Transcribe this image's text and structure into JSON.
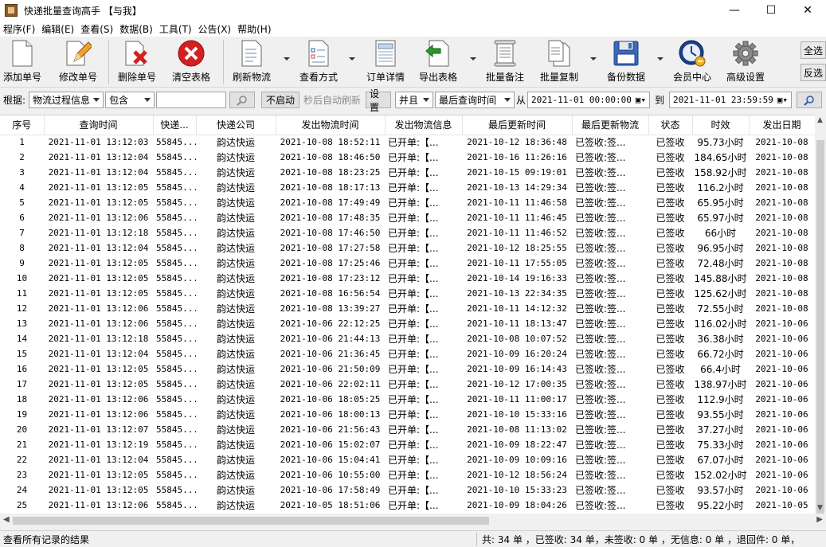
{
  "window": {
    "title": "快递批量查询高手 【与我】",
    "minimize": "—",
    "maximize": "☐",
    "close": "✕"
  },
  "menu": [
    "程序(F)",
    "编辑(E)",
    "查看(S)",
    "数据(B)",
    "工具(T)",
    "公告(X)",
    "帮助(H)"
  ],
  "toolbar": {
    "add": "添加单号",
    "edit": "修改单号",
    "delete": "删除单号",
    "clear": "清空表格",
    "refresh": "刷新物流",
    "view_mode": "查看方式",
    "order_detail": "订单详情",
    "export": "导出表格",
    "batch_note": "批量备注",
    "batch_copy": "批量复制",
    "backup": "备份数据",
    "member": "会员中心",
    "settings": "高级设置",
    "select_all": "全选",
    "invert": "反选"
  },
  "filter": {
    "label": "根据:",
    "field": "物流过程信息",
    "op": "包含",
    "search_value": "",
    "auto_off": "不启动",
    "auto_label": "秒后自动刷新",
    "settings": "设置",
    "logic": "并且",
    "time_field": "最后查询时间",
    "from_label": "从",
    "from": "2021-11-01 00:00:00",
    "to_label": "到",
    "to": "2021-11-01 23:59:59"
  },
  "table": {
    "headers": [
      "序号",
      "查询时间",
      "快递...",
      "快递公司",
      "发出物流时间",
      "发出物流信息",
      "最后更新时间",
      "最后更新物流",
      "状态",
      "时效",
      "发出日期"
    ],
    "rows": [
      [
        "1",
        "2021-11-01 13:12:03",
        "55845...",
        "韵达快运",
        "2021-10-08 18:52:11",
        "已开单:【...",
        "2021-10-12 18:36:48",
        "已签收:签...",
        "已签收",
        "95.73小时",
        "2021-10-08"
      ],
      [
        "2",
        "2021-11-01 13:12:04",
        "55845...",
        "韵达快运",
        "2021-10-08 18:46:50",
        "已开单:【...",
        "2021-10-16 11:26:16",
        "已签收:签...",
        "已签收",
        "184.65小时",
        "2021-10-08"
      ],
      [
        "3",
        "2021-11-01 13:12:04",
        "55845...",
        "韵达快运",
        "2021-10-08 18:23:25",
        "已开单:【...",
        "2021-10-15 09:19:01",
        "已签收:签...",
        "已签收",
        "158.92小时",
        "2021-10-08"
      ],
      [
        "4",
        "2021-11-01 13:12:05",
        "55845...",
        "韵达快运",
        "2021-10-08 18:17:13",
        "已开单:【...",
        "2021-10-13 14:29:34",
        "已签收:签...",
        "已签收",
        "116.2小时",
        "2021-10-08"
      ],
      [
        "5",
        "2021-11-01 13:12:05",
        "55845...",
        "韵达快运",
        "2021-10-08 17:49:49",
        "已开单:【...",
        "2021-10-11 11:46:58",
        "已签收:签...",
        "已签收",
        "65.95小时",
        "2021-10-08"
      ],
      [
        "6",
        "2021-11-01 13:12:06",
        "55845...",
        "韵达快运",
        "2021-10-08 17:48:35",
        "已开单:【...",
        "2021-10-11 11:46:45",
        "已签收:签...",
        "已签收",
        "65.97小时",
        "2021-10-08"
      ],
      [
        "7",
        "2021-11-01 13:12:18",
        "55845...",
        "韵达快运",
        "2021-10-08 17:46:50",
        "已开单:【...",
        "2021-10-11 11:46:52",
        "已签收:签...",
        "已签收",
        "66小时",
        "2021-10-08"
      ],
      [
        "8",
        "2021-11-01 13:12:04",
        "55845...",
        "韵达快运",
        "2021-10-08 17:27:58",
        "已开单:【...",
        "2021-10-12 18:25:55",
        "已签收:签...",
        "已签收",
        "96.95小时",
        "2021-10-08"
      ],
      [
        "9",
        "2021-11-01 13:12:05",
        "55845...",
        "韵达快运",
        "2021-10-08 17:25:46",
        "已开单:【...",
        "2021-10-11 17:55:05",
        "已签收:签...",
        "已签收",
        "72.48小时",
        "2021-10-08"
      ],
      [
        "10",
        "2021-11-01 13:12:05",
        "55845...",
        "韵达快运",
        "2021-10-08 17:23:12",
        "已开单:【...",
        "2021-10-14 19:16:33",
        "已签收:签...",
        "已签收",
        "145.88小时",
        "2021-10-08"
      ],
      [
        "11",
        "2021-11-01 13:12:05",
        "55845...",
        "韵达快运",
        "2021-10-08 16:56:54",
        "已开单:【...",
        "2021-10-13 22:34:35",
        "已签收:签...",
        "已签收",
        "125.62小时",
        "2021-10-08"
      ],
      [
        "12",
        "2021-11-01 13:12:06",
        "55845...",
        "韵达快运",
        "2021-10-08 13:39:27",
        "已开单:【...",
        "2021-10-11 14:12:32",
        "已签收:签...",
        "已签收",
        "72.55小时",
        "2021-10-08"
      ],
      [
        "13",
        "2021-11-01 13:12:06",
        "55845...",
        "韵达快运",
        "2021-10-06 22:12:25",
        "已开单:【...",
        "2021-10-11 18:13:47",
        "已签收:签...",
        "已签收",
        "116.02小时",
        "2021-10-06"
      ],
      [
        "14",
        "2021-11-01 13:12:18",
        "55845...",
        "韵达快运",
        "2021-10-06 21:44:13",
        "已开单:【...",
        "2021-10-08 10:07:52",
        "已签收:签...",
        "已签收",
        "36.38小时",
        "2021-10-06"
      ],
      [
        "15",
        "2021-11-01 13:12:04",
        "55845...",
        "韵达快运",
        "2021-10-06 21:36:45",
        "已开单:【...",
        "2021-10-09 16:20:24",
        "已签收:签...",
        "已签收",
        "66.72小时",
        "2021-10-06"
      ],
      [
        "16",
        "2021-11-01 13:12:05",
        "55845...",
        "韵达快运",
        "2021-10-06 21:50:09",
        "已开单:【...",
        "2021-10-09 16:14:43",
        "已签收:签...",
        "已签收",
        "66.4小时",
        "2021-10-06"
      ],
      [
        "17",
        "2021-11-01 13:12:05",
        "55845...",
        "韵达快运",
        "2021-10-06 22:02:11",
        "已开单:【...",
        "2021-10-12 17:00:35",
        "已签收:签...",
        "已签收",
        "138.97小时",
        "2021-10-06"
      ],
      [
        "18",
        "2021-11-01 13:12:06",
        "55845...",
        "韵达快运",
        "2021-10-06 18:05:25",
        "已开单:【...",
        "2021-10-11 11:00:17",
        "已签收:签...",
        "已签收",
        "112.9小时",
        "2021-10-06"
      ],
      [
        "19",
        "2021-11-01 13:12:06",
        "55845...",
        "韵达快运",
        "2021-10-06 18:00:13",
        "已开单:【...",
        "2021-10-10 15:33:16",
        "已签收:签...",
        "已签收",
        "93.55小时",
        "2021-10-06"
      ],
      [
        "20",
        "2021-11-01 13:12:07",
        "55845...",
        "韵达快运",
        "2021-10-06 21:56:43",
        "已开单:【...",
        "2021-10-08 11:13:02",
        "已签收:签...",
        "已签收",
        "37.27小时",
        "2021-10-06"
      ],
      [
        "21",
        "2021-11-01 13:12:19",
        "55845...",
        "韵达快运",
        "2021-10-06 15:02:07",
        "已开单:【...",
        "2021-10-09 18:22:47",
        "已签收:签...",
        "已签收",
        "75.33小时",
        "2021-10-06"
      ],
      [
        "22",
        "2021-11-01 13:12:04",
        "55845...",
        "韵达快运",
        "2021-10-06 15:04:41",
        "已开单:【...",
        "2021-10-09 10:09:16",
        "已签收:签...",
        "已签收",
        "67.07小时",
        "2021-10-06"
      ],
      [
        "23",
        "2021-11-01 13:12:05",
        "55845...",
        "韵达快运",
        "2021-10-06 10:55:00",
        "已开单:【...",
        "2021-10-12 18:56:24",
        "已签收:签...",
        "已签收",
        "152.02小时",
        "2021-10-06"
      ],
      [
        "24",
        "2021-11-01 13:12:05",
        "55845...",
        "韵达快运",
        "2021-10-06 17:58:49",
        "已开单:【...",
        "2021-10-10 15:33:23",
        "已签收:签...",
        "已签收",
        "93.57小时",
        "2021-10-06"
      ],
      [
        "25",
        "2021-11-01 13:12:06",
        "55845...",
        "韵达快运",
        "2021-10-05 18:51:06",
        "已开单:【...",
        "2021-10-09 18:04:26",
        "已签收:签...",
        "已签收",
        "95.22小时",
        "2021-10-05"
      ]
    ]
  },
  "status": {
    "left": "查看所有记录的结果",
    "right": "共: 34 单 ，已签收: 34 单，未签收: 0 单 ，无信息: 0 单 ，退回件: 0 单，"
  },
  "colors": {
    "delete_red": "#d42020",
    "back_green": "#2a9a2a",
    "member_blue": "#1c3f8a"
  }
}
